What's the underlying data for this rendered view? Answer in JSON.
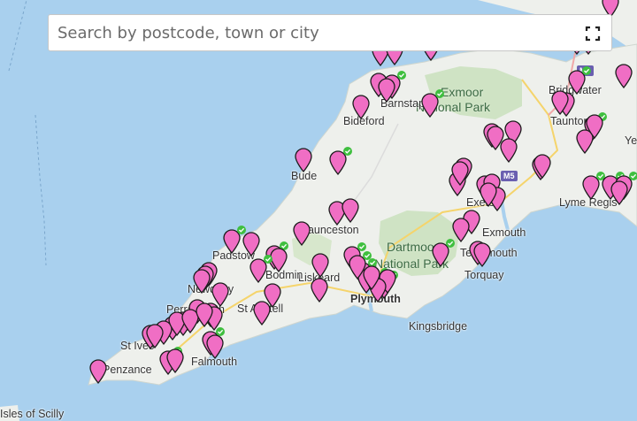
{
  "search": {
    "placeholder": "Search by postcode, town or city",
    "value": ""
  },
  "fullscreen_icon": "fullscreen-icon",
  "colors": {
    "sea": "#a9d0ee",
    "land": "#eef0ec",
    "park": "#cfe3c4",
    "pin": "#f06ec4",
    "pin_stroke": "#1c1c1c",
    "check": "#3fbf3f",
    "road": "#6a5fb0"
  },
  "places": [
    {
      "name": "Exmoor",
      "kind": "park"
    },
    {
      "name": "National Park",
      "kind": "park"
    },
    {
      "name": "Dartmoor",
      "kind": "park"
    },
    {
      "name": "National Park",
      "kind": "park"
    },
    {
      "name": "Bridgwater",
      "kind": "town"
    },
    {
      "name": "Barnstaple",
      "kind": "town"
    },
    {
      "name": "Bideford",
      "kind": "town"
    },
    {
      "name": "Taunton",
      "kind": "town"
    },
    {
      "name": "Bude",
      "kind": "town"
    },
    {
      "name": "Exeter",
      "kind": "town"
    },
    {
      "name": "Exmouth",
      "kind": "town"
    },
    {
      "name": "Teignmouth",
      "kind": "town"
    },
    {
      "name": "Torquay",
      "kind": "town"
    },
    {
      "name": "Launceston",
      "kind": "town"
    },
    {
      "name": "Lyme Regis",
      "kind": "town"
    },
    {
      "name": "Padstow",
      "kind": "town"
    },
    {
      "name": "Newquay",
      "kind": "town"
    },
    {
      "name": "Liskeard",
      "kind": "town"
    },
    {
      "name": "Bodmin",
      "kind": "town"
    },
    {
      "name": "Plymouth",
      "kind": "town"
    },
    {
      "name": "Perranporth",
      "kind": "town"
    },
    {
      "name": "St Austell",
      "kind": "town"
    },
    {
      "name": "Kingsbridge",
      "kind": "town"
    },
    {
      "name": "St Ives",
      "kind": "town"
    },
    {
      "name": "Falmouth",
      "kind": "town"
    },
    {
      "name": "Penzance",
      "kind": "town"
    },
    {
      "name": "Yeovil",
      "kind": "town"
    },
    {
      "name": "Isles of Scilly",
      "kind": "town"
    }
  ],
  "road_badges": [
    "M5",
    "M5"
  ],
  "markers_count": 120
}
